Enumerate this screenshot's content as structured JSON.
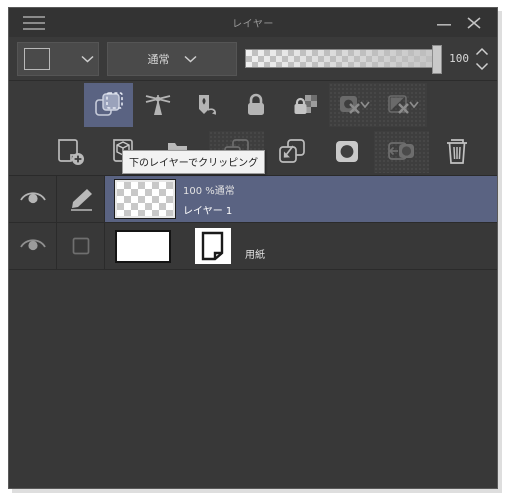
{
  "window": {
    "title": "レイヤー",
    "menu_icon": "hamburger-icon",
    "minimize_label": "—",
    "close_label": "✕",
    "bg_color": "#323232",
    "accent_color": "#5a6382"
  },
  "blend_bar": {
    "mask_swatch_label": "",
    "blend_mode": "通常",
    "opacity_value": "100",
    "opacity_percent": 100
  },
  "toolbar_primary": {
    "buttons": [
      {
        "name": "clip-to-layer-below-icon",
        "label": "下のレイヤーでクリッピング",
        "state": "active"
      },
      {
        "name": "reference-layer-icon",
        "label": "参照レイヤーに設定",
        "state": "normal"
      },
      {
        "name": "draft-layer-icon",
        "label": "下書きレイヤーに設定",
        "state": "normal"
      },
      {
        "name": "lock-layer-icon",
        "label": "レイヤーをロック",
        "state": "normal"
      },
      {
        "name": "lock-transparent-pixels-icon",
        "label": "透明ピクセルをロック",
        "state": "normal"
      },
      {
        "name": "mask-enable-icon",
        "label": "レイヤーマスクを有効化",
        "state": "disabled"
      },
      {
        "name": "mask-clip-icon",
        "label": "マスクの範囲外を表示",
        "state": "disabled"
      }
    ]
  },
  "toolbar_secondary": {
    "buttons": [
      {
        "name": "new-raster-layer-icon",
        "label": "新規ラスターレイヤー",
        "state": "normal"
      },
      {
        "name": "new-3d-layer-icon",
        "label": "新規レイヤー",
        "state": "normal"
      },
      {
        "name": "new-folder-icon",
        "label": "新規レイヤーフォルダー",
        "state": "normal"
      },
      {
        "name": "transfer-to-lower-layer-icon",
        "label": "下のレイヤーに転送",
        "state": "disabled"
      },
      {
        "name": "duplicate-layer-icon",
        "label": "レイヤーを複製",
        "state": "normal"
      },
      {
        "name": "create-mask-icon",
        "label": "レイヤーマスクを作成",
        "state": "normal"
      },
      {
        "name": "apply-mask-icon",
        "label": "レイヤーマスクを適用",
        "state": "disabled"
      },
      {
        "name": "delete-layer-icon",
        "label": "レイヤーを削除",
        "state": "normal"
      }
    ]
  },
  "tooltip": {
    "text": "下のレイヤーでクリッピング",
    "visible": true
  },
  "layers": [
    {
      "name": "レイヤー 1",
      "meta": "100 %通常",
      "visible": true,
      "selected": true,
      "thumbnail": "transparent",
      "edit_icon": "pencil-icon"
    },
    {
      "name": "用紙",
      "meta": "",
      "visible": true,
      "selected": false,
      "thumbnail": "white",
      "edit_icon": "empty-square-icon"
    }
  ]
}
